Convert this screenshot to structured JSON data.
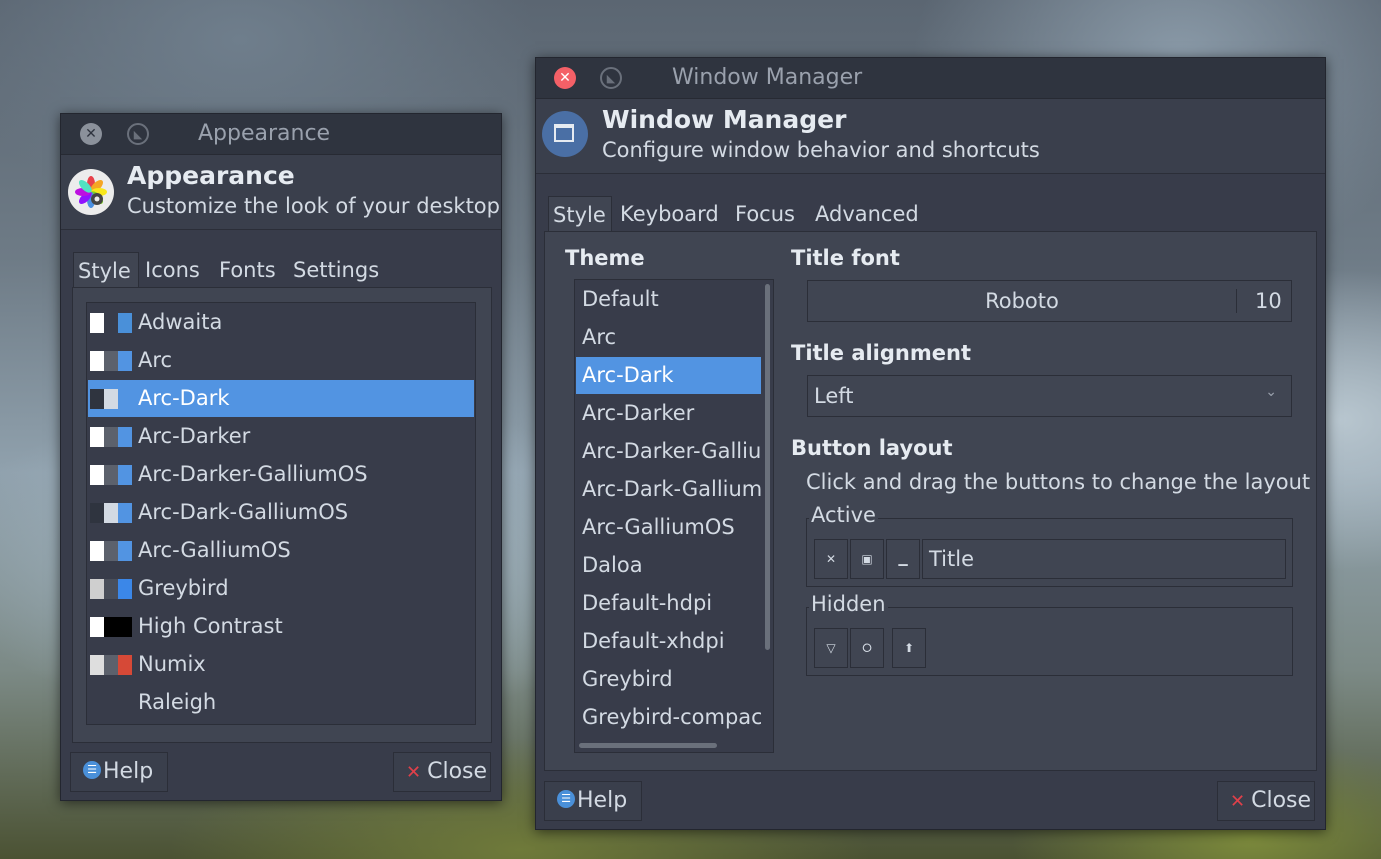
{
  "appearance": {
    "window_title": "Appearance",
    "header_title": "Appearance",
    "header_subtitle": "Customize the look of your desktop",
    "header_icon": "palette-icon",
    "tabs": [
      {
        "label": "Style",
        "active": true
      },
      {
        "label": "Icons",
        "active": false
      },
      {
        "label": "Fonts",
        "active": false
      },
      {
        "label": "Settings",
        "active": false
      }
    ],
    "styles": [
      {
        "label": "Adwaita",
        "swatch": [
          "#ffffff",
          "#383c4a",
          "#4a90d9"
        ]
      },
      {
        "label": "Arc",
        "swatch": [
          "#ffffff",
          "#5c616c",
          "#5294e2"
        ]
      },
      {
        "label": "Arc-Dark",
        "swatch": [
          "#2f343f",
          "#d3dae3",
          "#5294e2"
        ],
        "selected": true
      },
      {
        "label": "Arc-Darker",
        "swatch": [
          "#ffffff",
          "#5c616c",
          "#5294e2"
        ]
      },
      {
        "label": "Arc-Darker-GalliumOS",
        "swatch": [
          "#ffffff",
          "#5c616c",
          "#5294e2"
        ]
      },
      {
        "label": "Arc-Dark-GalliumOS",
        "swatch": [
          "#2f343f",
          "#d3dae3",
          "#5294e2"
        ]
      },
      {
        "label": "Arc-GalliumOS",
        "swatch": [
          "#ffffff",
          "#5c616c",
          "#5294e2"
        ]
      },
      {
        "label": "Greybird",
        "swatch": [
          "#cfcfcf",
          "#4a4f5a",
          "#3b87e8"
        ]
      },
      {
        "label": "High Contrast",
        "swatch": [
          "#ffffff",
          "#000000",
          "#000000"
        ]
      },
      {
        "label": "Numix",
        "swatch": [
          "#dedede",
          "#5c616c",
          "#d64937"
        ]
      },
      {
        "label": "Raleigh",
        "swatch": null
      }
    ],
    "help_label": "Help",
    "close_label": "Close"
  },
  "window_manager": {
    "window_title": "Window Manager",
    "header_title": "Window Manager",
    "header_subtitle": "Configure window behavior and shortcuts",
    "header_icon": "window-icon",
    "tabs": [
      {
        "label": "Style",
        "active": true
      },
      {
        "label": "Keyboard",
        "active": false
      },
      {
        "label": "Focus",
        "active": false
      },
      {
        "label": "Advanced",
        "active": false
      }
    ],
    "theme_label": "Theme",
    "themes": [
      {
        "label": "Default"
      },
      {
        "label": "Arc"
      },
      {
        "label": "Arc-Dark",
        "selected": true
      },
      {
        "label": "Arc-Darker"
      },
      {
        "label": "Arc-Darker-GalliumOS"
      },
      {
        "label": "Arc-Dark-GalliumOS"
      },
      {
        "label": "Arc-GalliumOS"
      },
      {
        "label": "Daloa"
      },
      {
        "label": "Default-hdpi"
      },
      {
        "label": "Default-xhdpi"
      },
      {
        "label": "Greybird"
      },
      {
        "label": "Greybird-compact"
      }
    ],
    "title_font_label": "Title font",
    "title_font_name": "Roboto",
    "title_font_size": "10",
    "title_alignment_label": "Title alignment",
    "title_alignment_value": "Left",
    "button_layout_label": "Button layout",
    "button_layout_hint": "Click and drag the buttons to change the layout",
    "active_label": "Active",
    "active_buttons": [
      "close-icon",
      "maximize-icon",
      "minimize-icon"
    ],
    "active_title": "Title",
    "hidden_label": "Hidden",
    "hidden_buttons": [
      "menu-icon",
      "stick-icon",
      "shade-icon"
    ],
    "help_label": "Help",
    "close_label": "Close"
  }
}
